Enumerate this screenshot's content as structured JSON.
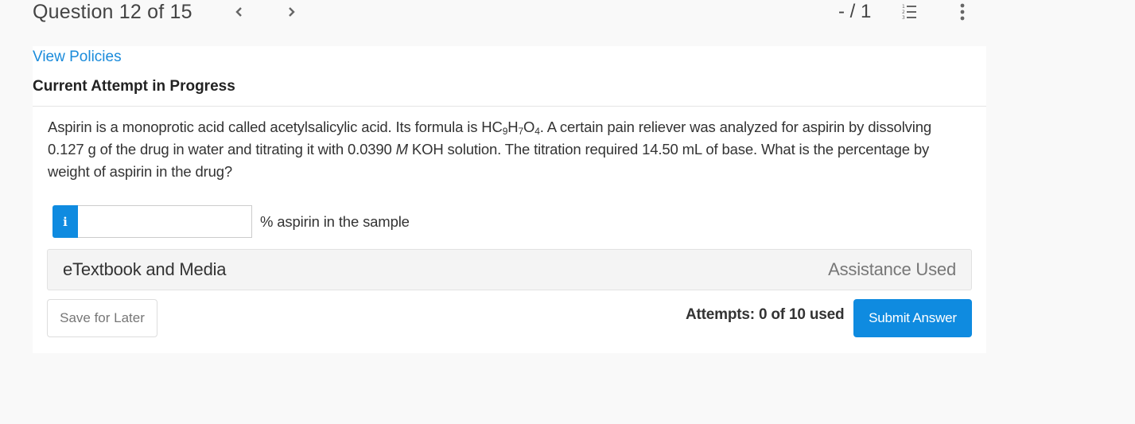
{
  "header": {
    "question_title": "Question 12 of 15",
    "prev_icon": "chevron-left-icon",
    "next_icon": "chevron-right-icon",
    "score": "- / 1",
    "list_icon": "numbered-list-icon",
    "more_icon": "more-vertical-icon"
  },
  "card": {
    "view_policies_link": "View Policies",
    "attempt_title": "Current Attempt in Progress",
    "question": {
      "part1": "Aspirin is a monoprotic acid called acetylsalicylic acid. Its formula is HC",
      "sub1": "9",
      "part2": "H",
      "sub2": "7",
      "part3": "O",
      "sub3": "4",
      "part4": ". A certain pain reliever was analyzed for aspirin by dissolving 0.127 g of the drug in water and titrating it with 0.0390 ",
      "molarity_unit": "M",
      "part5": " KOH solution. The titration required 14.50 mL of base. What is the percentage by weight of aspirin in the drug?"
    },
    "answer": {
      "info_badge": "i",
      "value": "",
      "placeholder": "",
      "unit_label": "% aspirin in the sample"
    },
    "etextbook": {
      "label": "eTextbook and Media",
      "assistance_label": "Assistance Used"
    },
    "footer": {
      "save_label": "Save for Later",
      "attempts_text": "Attempts: 0 of 10 used",
      "submit_label": "Submit Answer"
    }
  },
  "colors": {
    "accent": "#0f8be0",
    "link": "#1a8bdb",
    "page_background": "#f9f9f9"
  }
}
